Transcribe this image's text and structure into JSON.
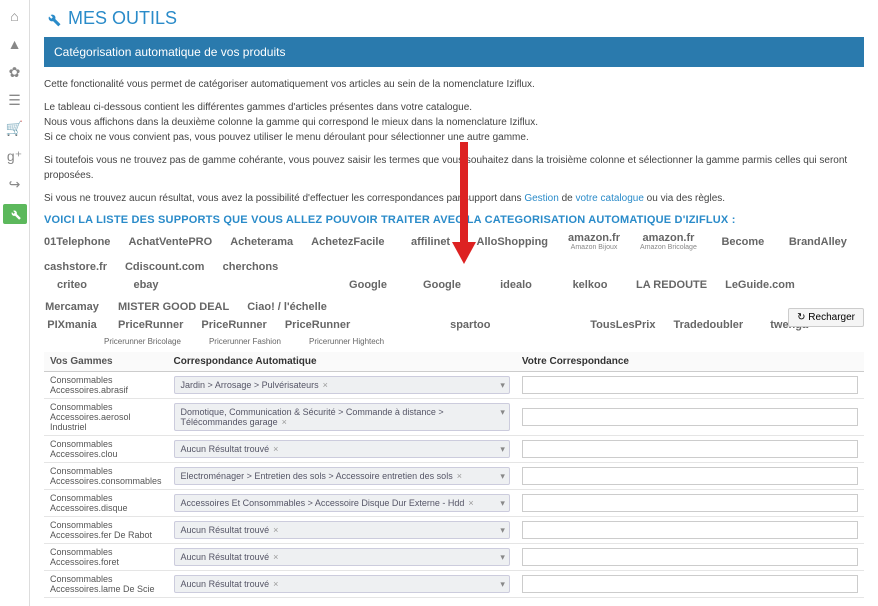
{
  "page": {
    "title": "MES OUTILS"
  },
  "banner": {
    "title": "Catégorisation automatique de vos produits"
  },
  "intro": {
    "p1": "Cette fonctionalité vous permet de catégoriser automatiquement vos articles au sein de la nomenclature Iziflux.",
    "p2a": "Le tableau ci-dessous contient les différentes gammes d'articles présentes dans votre catalogue.",
    "p2b": "Nous vous affichons dans la deuxième colonne la gamme qui correspond le mieux dans la nomenclature Iziflux.",
    "p2c": "Si ce choix ne vous convient pas, vous pouvez utiliser le menu déroulant pour sélectionner une autre gamme.",
    "p3": "Si toutefois vous ne trouvez pas de gamme cohérante, vous pouvez saisir les termes que vous souhaitez dans la troisième colonne et sélectionner la gamme parmis celles qui seront proposées.",
    "p4a": "Si vous ne trouvez aucun résultat, vous avez la possibilité d'effectuer les correspondances par support dans ",
    "p4link1": "Gestion",
    "p4mid": " de ",
    "p4link2": "votre catalogue",
    "p4b": " ou via des règles."
  },
  "supports_heading": "VOICI LA LISTE DES SUPPORTS QUE VOUS ALLEZ POUVOIR TRAITER AVEC LA CATEGORISATION AUTOMATIQUE D'IZIFLUX :",
  "logos_row1": [
    "01Telephone",
    "AchatVentePRO",
    "Acheterama",
    "AchetezFacile",
    "affilinet",
    "AlloShopping",
    "amazon.fr",
    "amazon.fr",
    "Become",
    "BrandAlley",
    "cashstore.fr",
    "Cdiscount.com",
    "cherchons"
  ],
  "logos_row1_sub": [
    "",
    "",
    "",
    "",
    "",
    "",
    "Amazon Bijoux",
    "Amazon Bricolage",
    "",
    "",
    "",
    "",
    ""
  ],
  "logos_row2": [
    "criteo",
    "ebay",
    "",
    "",
    "Google",
    "Google",
    "idealo",
    "kelkoo",
    "LA REDOUTE",
    "LeGuide.com",
    "Mercamay",
    "MISTER GOOD DEAL",
    "Ciao! / l'échelle"
  ],
  "logos_row3": [
    "PIXmania",
    "PriceRunner",
    "PriceRunner",
    "PriceRunner",
    "",
    "spartoo",
    "",
    "TousLesPrix",
    "Tradedoubler",
    "twenga"
  ],
  "sublabels": [
    "Pricerunner Bricolage",
    "Pricerunner Fashion",
    "Pricerunner Hightech"
  ],
  "reload": "↻ Recharger",
  "table": {
    "h1": "Vos Gammes",
    "h2": "Correspondance Automatique",
    "h3": "Votre Correspondance",
    "rows": [
      {
        "g": "Consommables Accessoires.abrasif",
        "c": "Jardin > Arrosage > Pulvérisateurs"
      },
      {
        "g": "Consommables Accessoires.aerosol Industriel",
        "c": "Domotique, Communication & Sécurité > Commande à distance > Télécommandes garage"
      },
      {
        "g": "Consommables Accessoires.clou",
        "c": "Aucun Résultat trouvé"
      },
      {
        "g": "Consommables Accessoires.consommables",
        "c": "Electroménager > Entretien des sols > Accessoire entretien des sols"
      },
      {
        "g": "Consommables Accessoires.disque",
        "c": "Accessoires Et Consommables > Accessoire Disque Dur Externe - Hdd"
      },
      {
        "g": "Consommables Accessoires.fer De Rabot",
        "c": "Aucun Résultat trouvé"
      },
      {
        "g": "Consommables Accessoires.foret",
        "c": "Aucun Résultat trouvé"
      },
      {
        "g": "Consommables Accessoires.lame De Scie",
        "c": "Aucun Résultat trouvé"
      }
    ]
  }
}
